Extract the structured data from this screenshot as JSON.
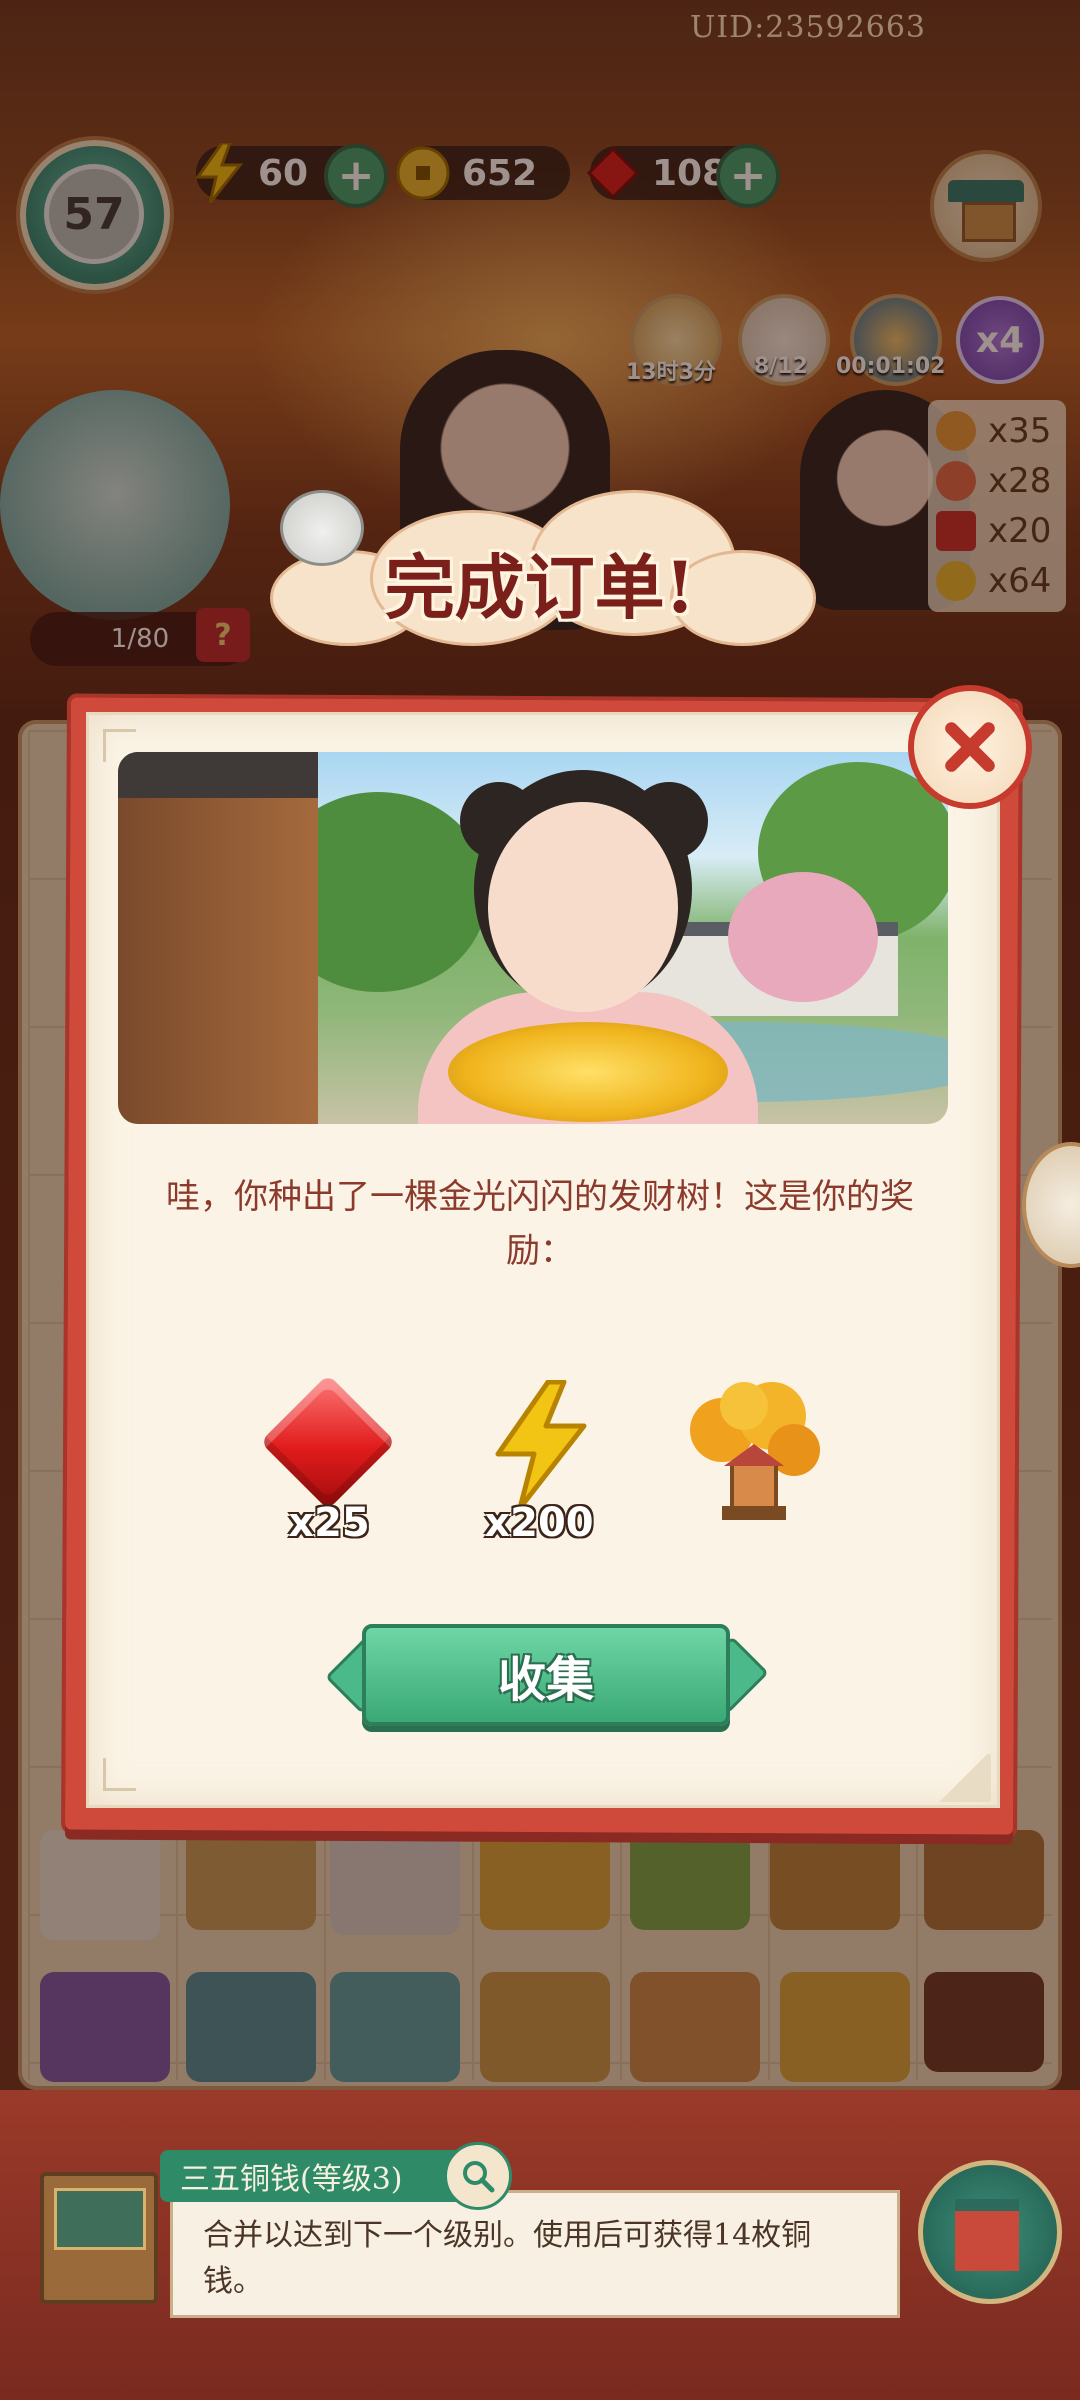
{
  "hud": {
    "uid": "UID:23592663",
    "level": "57",
    "energy": "60",
    "coins": "652",
    "gems": "108",
    "timer1": "13时3分",
    "cats": "8/12",
    "timer2": "00:01:02",
    "multiplier": "x4",
    "counters": [
      "x35",
      "x28",
      "x20",
      "x64"
    ],
    "order_progress": "1/80",
    "order_q": "?"
  },
  "banner": {
    "title": "完成订单!"
  },
  "dialog": {
    "message": "哇，你种出了一棵金光闪闪的发财树！这是你的奖励：",
    "rewards": [
      {
        "icon": "ruby-gem-icon",
        "count": "x25",
        "color": "#e01b1b"
      },
      {
        "icon": "energy-bolt-icon",
        "count": "x200",
        "color": "#f2c414"
      },
      {
        "icon": "money-tree-icon",
        "count": ""
      }
    ],
    "collect_label": "收集"
  },
  "info": {
    "item_title": "三五铜钱(等级3)",
    "item_desc": "合并以达到下一个级别。使用后可获得14枚铜钱。"
  },
  "colors": {
    "dialog_border": "#cf4a3a",
    "paper": "#fbf4e6",
    "accent_green": "#3aa976",
    "text_red": "#8b3a2c"
  }
}
